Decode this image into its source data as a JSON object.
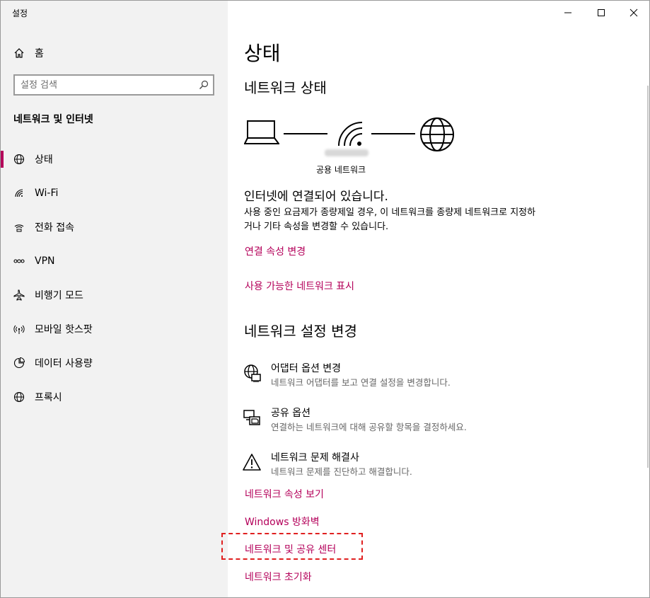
{
  "window": {
    "title": "설정"
  },
  "sidebar": {
    "home_label": "홈",
    "search_placeholder": "설정 검색",
    "section_title": "네트워크 및 인터넷",
    "items": [
      {
        "label": "상태",
        "icon": "globe-status-icon",
        "active": true
      },
      {
        "label": "Wi-Fi",
        "icon": "wifi-icon",
        "active": false
      },
      {
        "label": "전화 접속",
        "icon": "dial-up-icon",
        "active": false
      },
      {
        "label": "VPN",
        "icon": "vpn-icon",
        "active": false
      },
      {
        "label": "비행기 모드",
        "icon": "airplane-icon",
        "active": false
      },
      {
        "label": "모바일 핫스팟",
        "icon": "hotspot-icon",
        "active": false
      },
      {
        "label": "데이터 사용량",
        "icon": "data-usage-icon",
        "active": false
      },
      {
        "label": "프록시",
        "icon": "globe-icon",
        "active": false
      }
    ]
  },
  "main": {
    "title": "상태",
    "network_status_heading": "네트워크 상태",
    "network_type": "공용 네트워크",
    "connected_text": "인터넷에 연결되어 있습니다.",
    "metered_desc": "사용 중인 요금제가 종량제일 경우, 이 네트워크를 종량제 네트워크로 지정하거나 기타 속성을 변경할 수 있습니다.",
    "link_change_props": "연결 속성 변경",
    "link_show_networks": "사용 가능한 네트워크 표시",
    "change_settings_heading": "네트워크 설정 변경",
    "settings": [
      {
        "title": "어댑터 옵션 변경",
        "subtitle": "네트워크 어댑터를 보고 연결 설정을 변경합니다.",
        "icon": "adapter-icon"
      },
      {
        "title": "공유 옵션",
        "subtitle": "연결하는 네트워크에 대해 공유할 항목을 결정하세요.",
        "icon": "sharing-icon"
      },
      {
        "title": "네트워크 문제 해결사",
        "subtitle": "네트워크 문제를 진단하고 해결합니다.",
        "icon": "warning-icon"
      }
    ],
    "link_view_props": "네트워크 속성 보기",
    "link_firewall": "Windows 방화벽",
    "link_sharing_center": "네트워크 및 공유 센터",
    "link_reset": "네트워크 초기화"
  },
  "colors": {
    "accent": "#b4005a",
    "sidebar_bg": "#f2f2f2",
    "highlight": "#e02020"
  }
}
